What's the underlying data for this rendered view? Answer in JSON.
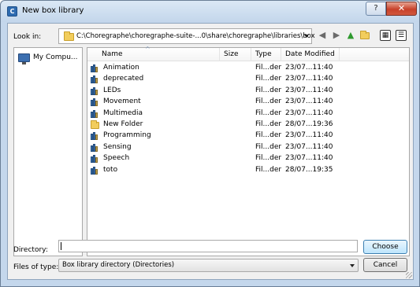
{
  "window": {
    "title": "New box library",
    "app_icon_letter": "C",
    "help_label": "?",
    "close_label": "✕"
  },
  "toolbar": {
    "look_in_label": "Look in:",
    "path": "C:\\Choregraphe\\choregraphe-suite-...0\\share\\choregraphe\\libraries\\box",
    "icons": [
      "back-icon",
      "forward-icon",
      "parent-folder-icon",
      "new-folder-icon",
      "list-view-icon",
      "detail-view-icon"
    ]
  },
  "sidebar": {
    "items": [
      {
        "label": "My Compu...",
        "icon": "computer-icon"
      }
    ]
  },
  "filelist": {
    "columns": [
      "Name",
      "Size",
      "Type",
      "Date Modified"
    ],
    "rows": [
      {
        "icon": "library",
        "name": "Animation",
        "size": "",
        "type": "Fil...der",
        "date": "23/07...11:40"
      },
      {
        "icon": "library",
        "name": "deprecated",
        "size": "",
        "type": "Fil...der",
        "date": "23/07...11:40"
      },
      {
        "icon": "library",
        "name": "LEDs",
        "size": "",
        "type": "Fil...der",
        "date": "23/07...11:40"
      },
      {
        "icon": "library",
        "name": "Movement",
        "size": "",
        "type": "Fil...der",
        "date": "23/07...11:40"
      },
      {
        "icon": "library",
        "name": "Multimedia",
        "size": "",
        "type": "Fil...der",
        "date": "23/07...11:40"
      },
      {
        "icon": "folder",
        "name": "New Folder",
        "size": "",
        "type": "Fil...der",
        "date": "28/07...19:36"
      },
      {
        "icon": "library",
        "name": "Programming",
        "size": "",
        "type": "Fil...der",
        "date": "23/07...11:40"
      },
      {
        "icon": "library",
        "name": "Sensing",
        "size": "",
        "type": "Fil...der",
        "date": "23/07...11:40"
      },
      {
        "icon": "library",
        "name": "Speech",
        "size": "",
        "type": "Fil...der",
        "date": "23/07...11:40"
      },
      {
        "icon": "library",
        "name": "toto",
        "size": "",
        "type": "Fil...der",
        "date": "28/07...19:35"
      }
    ]
  },
  "directory": {
    "label": "Directory:",
    "value": "",
    "choose_label": "Choose"
  },
  "files_of_type": {
    "label": "Files of type:",
    "selected": "Box library directory (Directories)",
    "cancel_label": "Cancel"
  },
  "colors": {
    "accent": "#3c7fb1",
    "title_bar": "#c4d7ec",
    "close_button": "#c7412a"
  }
}
